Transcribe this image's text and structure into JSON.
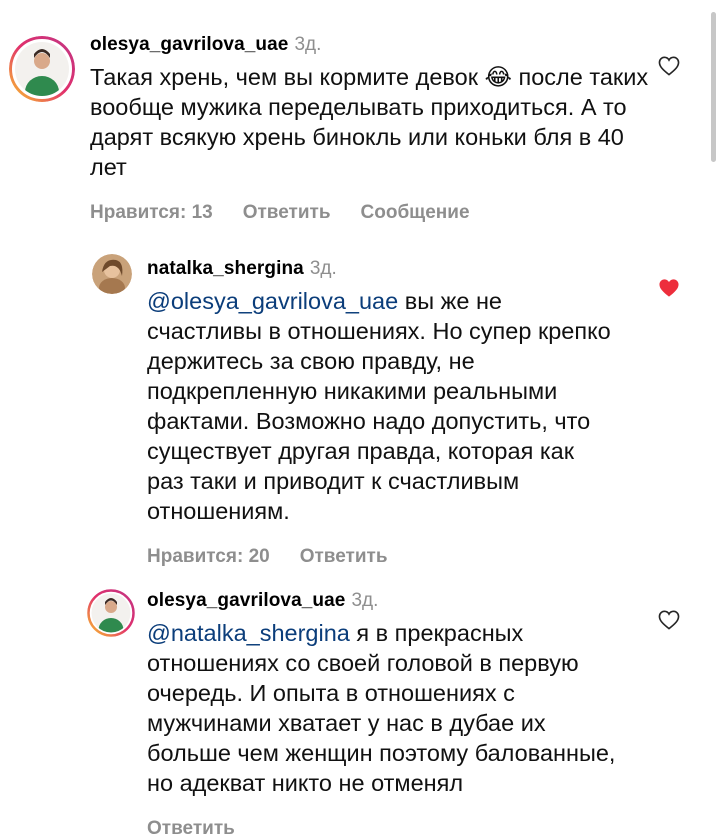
{
  "comments": [
    {
      "username": "olesya_gavrilova_uae",
      "time": "3д.",
      "mention": "",
      "text": "Такая хрень, чем вы кормите девок 😂 после таких вообще мужика переделывать приходиться. А то дарят всякую хрень бинокль или коньки бля в 40 лет",
      "likes_label": "Нравится: 13",
      "reply_label": "Ответить",
      "message_label": "Сообщение",
      "liked": false
    },
    {
      "username": "natalka_shergina",
      "time": "3д.",
      "mention": "@olesya_gavrilova_uae",
      "text": " вы же не счастливы в отношениях. Но супер крепко держитесь за свою правду, не подкрепленную никакими реальными фактами. Возможно надо допустить, что существует другая правда, которая как раз таки и приводит к счастливым отношениям.",
      "likes_label": "Нравится: 20",
      "reply_label": "Ответить",
      "liked": true
    },
    {
      "username": "olesya_gavrilova_uae",
      "time": "3д.",
      "mention": "@natalka_shergina",
      "text": " я в прекрасных отношениях со своей головой в первую очередь. И опыта в отношениях с мужчинами хватает у нас в дубае их больше чем женщин поэтому балованные, но адекват никто не отменял",
      "reply_label": "Ответить",
      "liked": false
    }
  ],
  "colors": {
    "heart_liked": "#ed2e3c",
    "meta_gray": "#8e8e8e",
    "mention": "#0b3d7a",
    "story_ring_start": "#f9c22e",
    "story_ring_end": "#c13584"
  }
}
